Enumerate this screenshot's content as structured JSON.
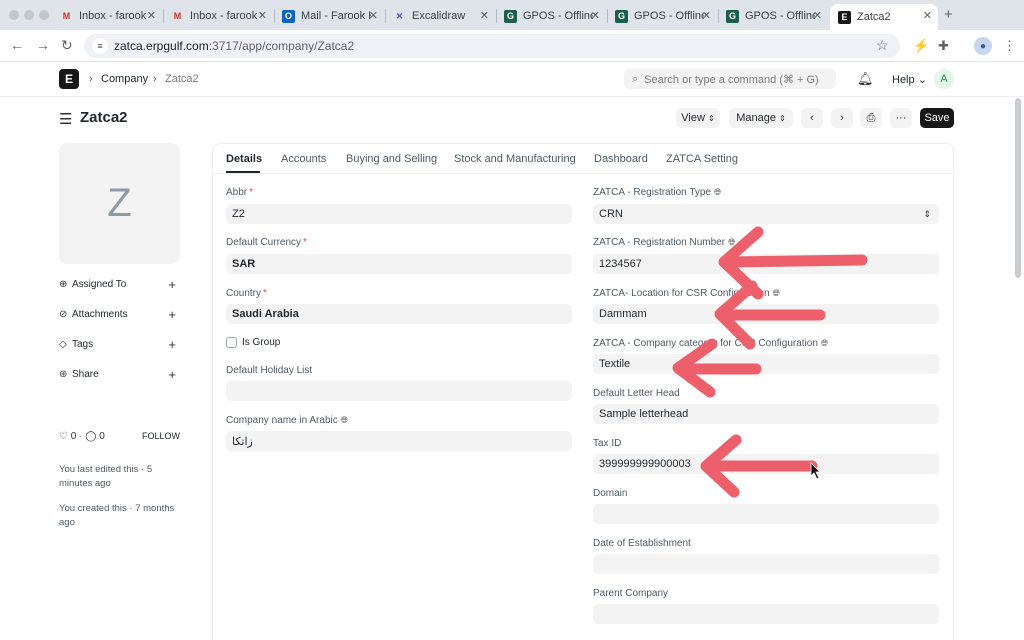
{
  "browser": {
    "tabs": [
      {
        "label": "Inbox - farook",
        "icon": "gmail-icon"
      },
      {
        "label": "Inbox - farook",
        "icon": "gmail-icon"
      },
      {
        "label": "Mail - Farook K",
        "icon": "outlook-icon"
      },
      {
        "label": "Excalidraw",
        "icon": "excalidraw-icon"
      },
      {
        "label": "GPOS - Offline",
        "icon": "gpos-icon"
      },
      {
        "label": "GPOS - Offline",
        "icon": "gpos-icon"
      },
      {
        "label": "GPOS - Offline",
        "icon": "gpos-icon"
      },
      {
        "label": "Zatca2",
        "icon": "erpnext-icon"
      }
    ],
    "url_host": "zatca.erpgulf.com",
    "url_path": ":3717/app/company/Zatca2"
  },
  "navbar": {
    "logo": "E",
    "breadcrumb_1": "Company",
    "breadcrumb_2": "Zatca2",
    "search_placeholder": "Search or type a command (⌘ + G)",
    "help_label": "Help",
    "user_initial": "A"
  },
  "page": {
    "title": "Zatca2",
    "view_label": "View",
    "manage_label": "Manage",
    "save_label": "Save"
  },
  "sidebar": {
    "avatar_letter": "Z",
    "items": [
      {
        "label": "Assigned To"
      },
      {
        "label": "Attachments"
      },
      {
        "label": "Tags"
      },
      {
        "label": "Share"
      }
    ],
    "likes": "0",
    "comments": "0",
    "follow_label": "FOLLOW",
    "last_edited": "You last edited this · 5 minutes ago",
    "created": "You created this · 7 months ago"
  },
  "form": {
    "tabs": [
      "Details",
      "Accounts",
      "Buying and Selling",
      "Stock and Manufacturing",
      "Dashboard",
      "ZATCA Setting"
    ],
    "left": {
      "abbr_label": "Abbr",
      "abbr_value": "Z2",
      "currency_label": "Default Currency",
      "currency_value": "SAR",
      "country_label": "Country",
      "country_value": "Saudi Arabia",
      "is_group_label": "Is Group",
      "holiday_label": "Default Holiday List",
      "holiday_value": "",
      "arabic_label": "Company name in Arabic",
      "arabic_value": "زاتكا"
    },
    "right": {
      "reg_type_label": "ZATCA - Registration Type",
      "reg_type_value": "CRN",
      "reg_number_label": "ZATCA - Registration Number",
      "reg_number_value": "1234567",
      "location_label": "ZATCA- Location for CSR Configuration",
      "location_value": "Dammam",
      "category_label": "ZATCA - Company category for CSR Configuration",
      "category_value": "Textile",
      "letterhead_label": "Default Letter Head",
      "letterhead_value": "Sample letterhead",
      "tax_label": "Tax ID",
      "tax_value": "399999999900003",
      "domain_label": "Domain",
      "domain_value": "",
      "establishment_label": "Date of Establishment",
      "establishment_value": "",
      "parent_label": "Parent Company",
      "parent_value": ""
    }
  },
  "colors": {
    "accent": "#171717",
    "arrow": "#ee5f6c",
    "required": "#e24c4c"
  }
}
